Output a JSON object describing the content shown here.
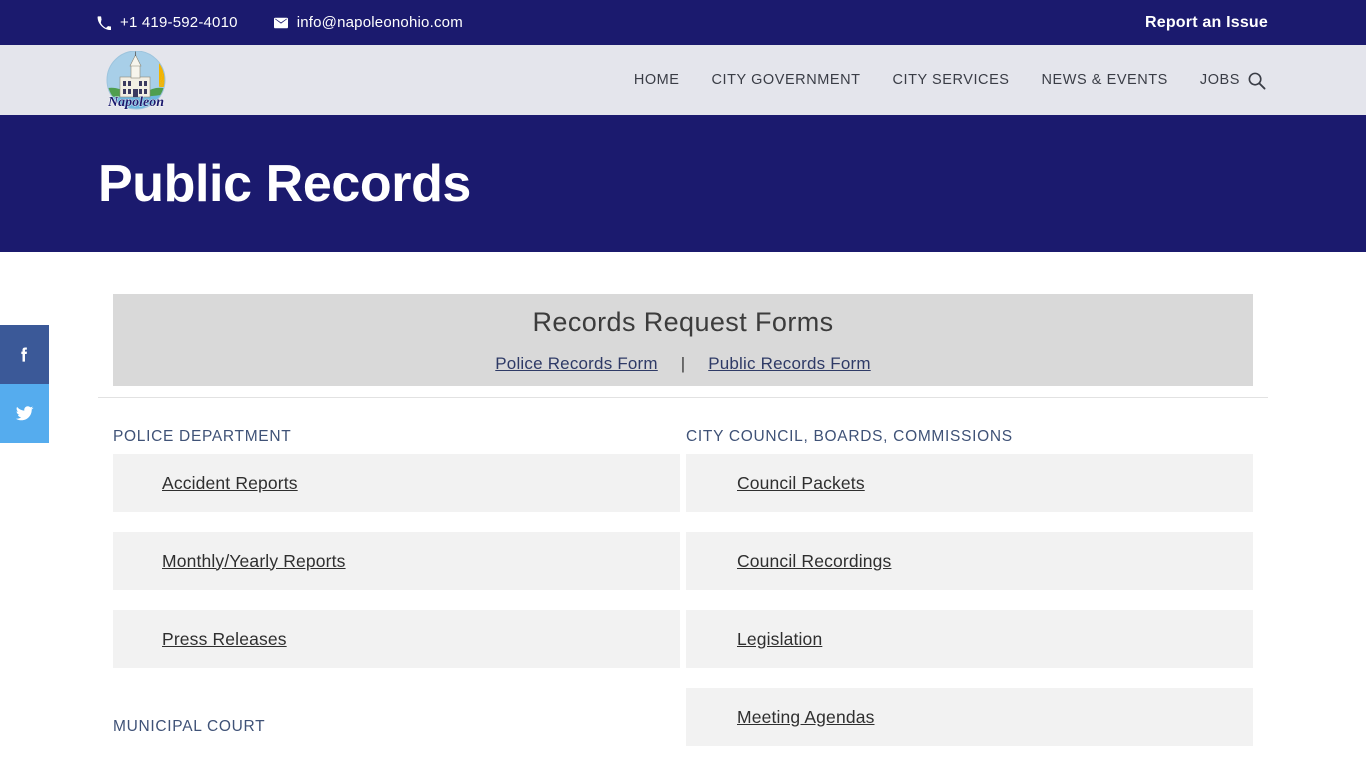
{
  "topbar": {
    "phone": "+1 419-592-4010",
    "phone_icon": "phone-icon",
    "email": "info@napoleonohio.com",
    "email_icon": "mail-icon",
    "report_label": "Report an Issue"
  },
  "header": {
    "logo_alt": "Napoleon",
    "logo_text": "Napoleon",
    "nav": [
      {
        "label": "HOME",
        "name": "nav-home"
      },
      {
        "label": "CITY GOVERNMENT",
        "name": "nav-city-government"
      },
      {
        "label": "CITY SERVICES",
        "name": "nav-city-services"
      },
      {
        "label": "NEWS & EVENTS",
        "name": "nav-news-events"
      },
      {
        "label": "JOBS",
        "name": "nav-jobs"
      }
    ],
    "search_icon": "search-icon"
  },
  "hero": {
    "title": "Public Records",
    "background": "#1b1a6e"
  },
  "social": [
    {
      "name": "facebook-share-button",
      "label": "Facebook",
      "color": "#3b5998"
    },
    {
      "name": "twitter-share-button",
      "label": "Twitter",
      "color": "#55acee"
    }
  ],
  "forms_banner": {
    "title": "Records Request Forms",
    "links": [
      {
        "label": "Police Records Form",
        "name": "police-records-form-link"
      },
      {
        "label": "Public Records Form",
        "name": "public-records-form-link"
      }
    ],
    "separator": "|",
    "background": "#d9d9d9"
  },
  "columns": [
    {
      "name": "column-left",
      "sections": [
        {
          "heading": "POLICE DEPARTMENT",
          "name": "section-police-department",
          "items": [
            {
              "label": "Accident Reports",
              "name": "link-accident-reports"
            },
            {
              "label": "Monthly/Yearly Reports",
              "name": "link-monthly-yearly-reports"
            },
            {
              "label": "Press Releases",
              "name": "link-press-releases"
            }
          ]
        },
        {
          "heading": "MUNICIPAL COURT",
          "name": "section-municipal-court",
          "items": []
        }
      ]
    },
    {
      "name": "column-right",
      "sections": [
        {
          "heading": "CITY COUNCIL, BOARDS, COMMISSIONS",
          "name": "section-city-council-boards-commissions",
          "items": [
            {
              "label": "Council Packets",
              "name": "link-council-packets"
            },
            {
              "label": "Council Recordings",
              "name": "link-council-recordings"
            },
            {
              "label": "Legislation",
              "name": "link-legislation"
            },
            {
              "label": "Meeting Agendas",
              "name": "link-meeting-agendas"
            }
          ]
        }
      ]
    }
  ],
  "colors": {
    "navy": "#1b1a6e",
    "header_bg": "#e4e5ec",
    "banner_bg": "#d9d9d9",
    "card_bg": "#f2f2f2",
    "heading_blue": "#3f5277",
    "link_navy": "#2e3a66"
  }
}
